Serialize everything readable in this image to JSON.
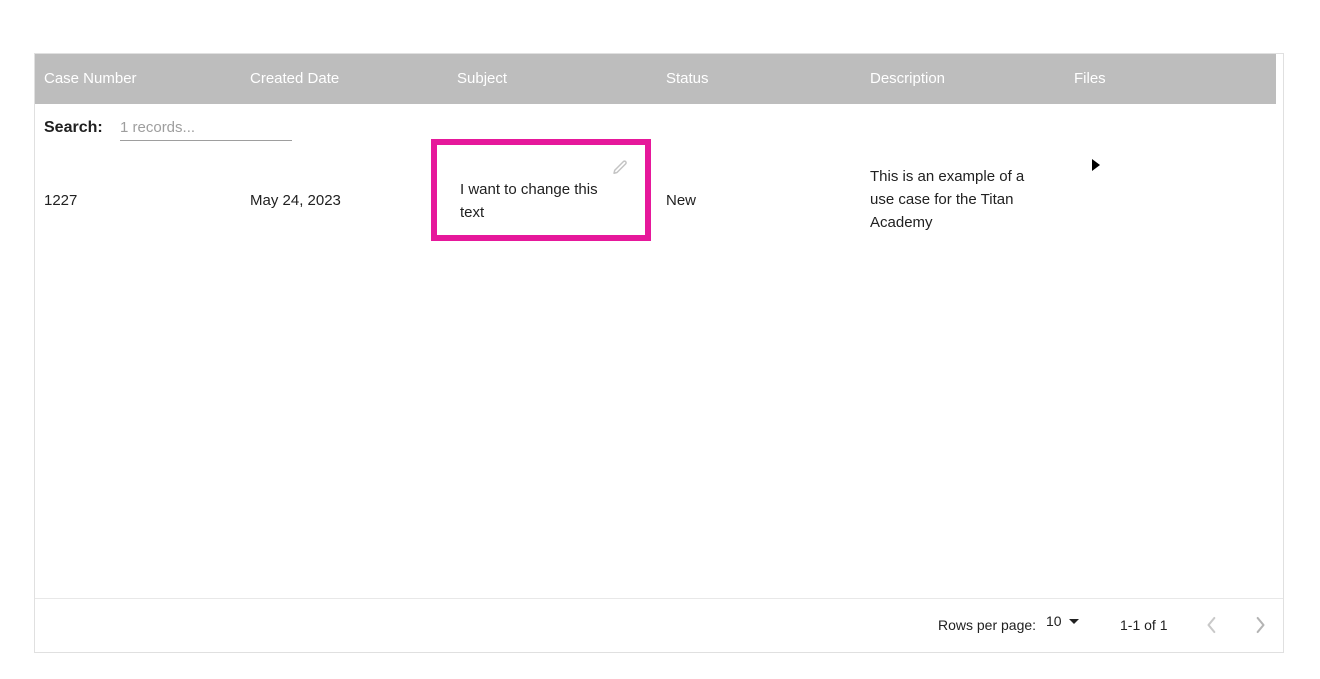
{
  "table": {
    "columns": [
      {
        "key": "case_number",
        "label": "Case Number"
      },
      {
        "key": "created_date",
        "label": "Created Date"
      },
      {
        "key": "subject",
        "label": "Subject"
      },
      {
        "key": "status",
        "label": "Status"
      },
      {
        "key": "description",
        "label": "Description"
      },
      {
        "key": "files",
        "label": "Files"
      }
    ],
    "rows": [
      {
        "case_number": "1227",
        "created_date": "May 24, 2023",
        "subject": "I want to change this text",
        "status": "New",
        "description": "This is an example of a use case for the Titan Academy",
        "files_expand_icon": "triangle-right-icon"
      }
    ]
  },
  "search": {
    "label": "Search:",
    "value": "",
    "placeholder": "1 records..."
  },
  "subject_cell": {
    "edit_icon": "pencil-icon",
    "highlight_color": "#e6189b"
  },
  "pagination": {
    "rows_per_page_label": "Rows per page:",
    "rows_per_page_value": "10",
    "caret_icon": "chevron-down-icon",
    "range_label": "1-1 of 1",
    "prev_icon": "chevron-left-icon",
    "next_icon": "chevron-right-icon"
  },
  "colors": {
    "header_background": "#bdbdbd",
    "header_text": "#ffffff",
    "highlight": "#e6189b",
    "body_text": "#212121",
    "muted_text": "#9e9e9e",
    "border": "#e0e0e0"
  }
}
